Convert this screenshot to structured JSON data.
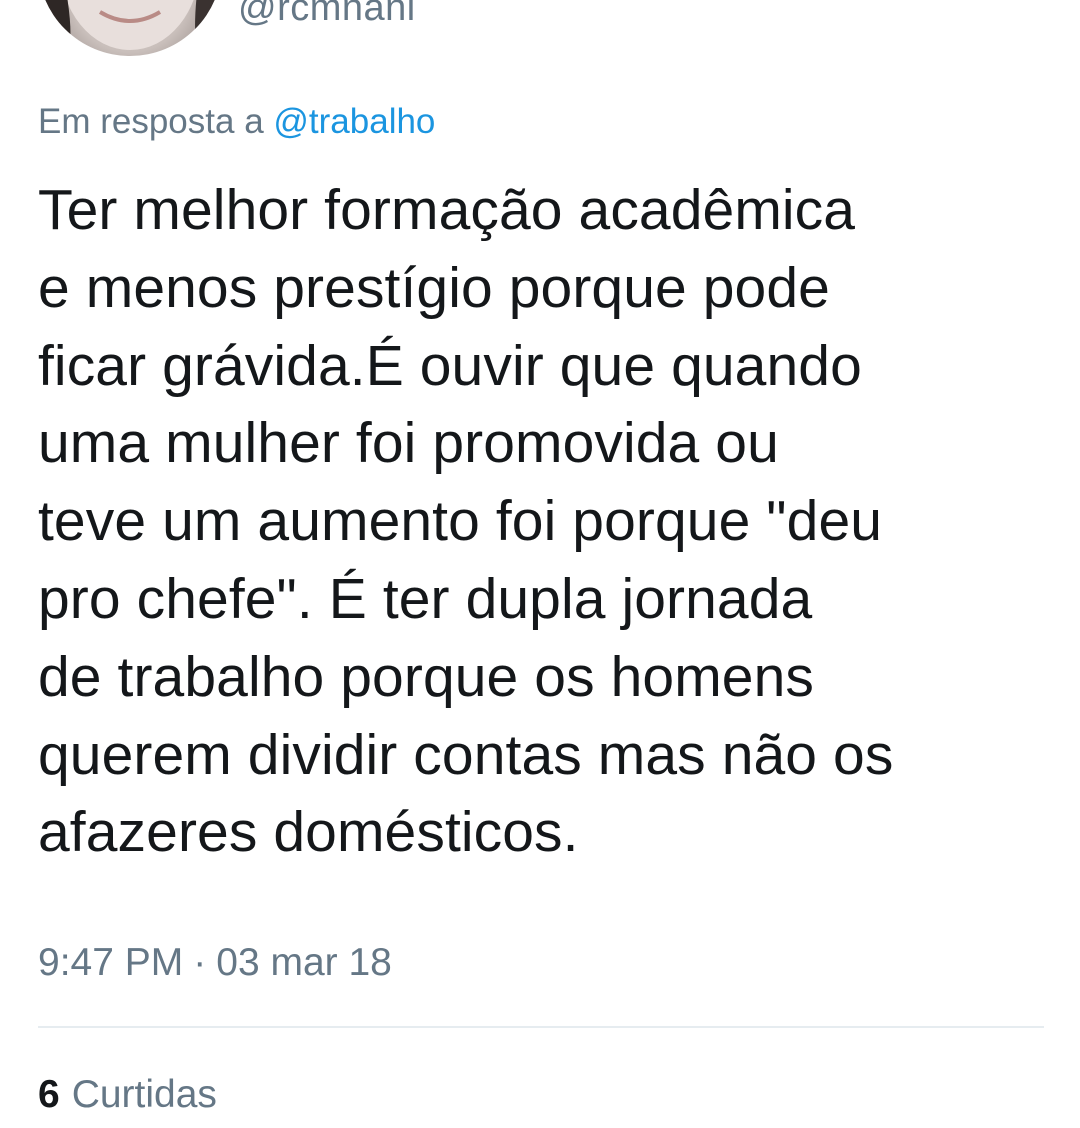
{
  "tweet": {
    "handle": "@rcmnani",
    "reply_prefix": "Em resposta a",
    "reply_mention": "@trabalho",
    "text": "Ter melhor formação acadêmica\ne menos prestígio porque pode\nficar grávida.É ouvir que quando\numa mulher foi promovida ou\nteve um aumento foi porque \"deu\npro chefe\". É ter dupla jornada\nde trabalho porque os homens\nquerem dividir contas mas não os\nafazeres domésticos.",
    "time": "9:47 PM",
    "separator": "·",
    "date": "03 mar 18",
    "likes_count": "6",
    "likes_label": "Curtidas"
  },
  "colors": {
    "secondary_text": "#657786",
    "link": "#1b95e0",
    "primary_text": "#14171a",
    "divider": "#e6ecf0"
  }
}
